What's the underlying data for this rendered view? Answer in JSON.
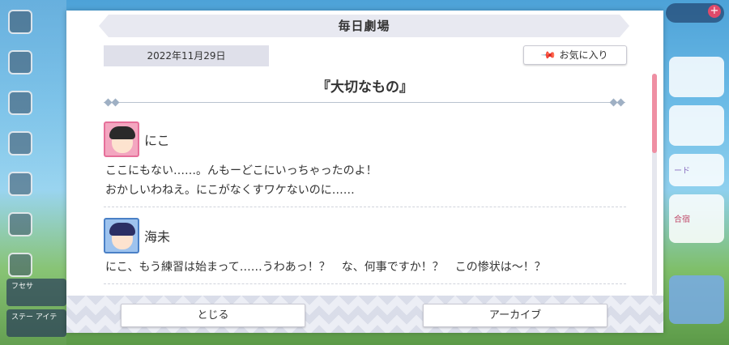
{
  "dialog": {
    "title": "毎日劇場",
    "date": "2022年11月29日",
    "favorite_label": "お気に入り",
    "story_title": "『大切なもの』",
    "entries": [
      {
        "speaker": "にこ",
        "lines": [
          "ここにもない……。んもーどこにいっちゃったのよ！",
          "おかしいわねえ。にこがなくすワケないのに……"
        ]
      },
      {
        "speaker": "海未",
        "lines": [
          "にこ、もう練習は始まって……うわあっ！？　な、何事ですか！？　この惨状は〜！？"
        ]
      }
    ],
    "close_label": "とじる",
    "archive_label": "アーカイブ"
  },
  "background": {
    "left_buttons": [
      "フセサ",
      "ステー アイテ"
    ],
    "right_cards": [
      "ード",
      "合宿"
    ]
  },
  "colors": {
    "accent_pink": "#ef8fa3",
    "title_bar": "#e8e9f1"
  },
  "icons": [
    "pin-icon",
    "menu-icon",
    "plus-icon"
  ]
}
